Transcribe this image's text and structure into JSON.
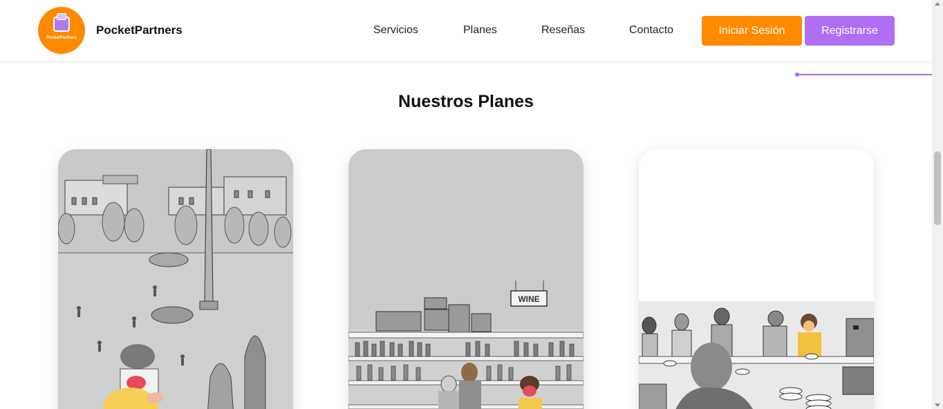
{
  "header": {
    "logo_text": "PocketPartners",
    "brand": "PocketPartners",
    "nav": [
      "Servicios",
      "Planes",
      "Reseñas",
      "Contacto"
    ],
    "login_label": "Iniciar Sesión",
    "register_label": "Registrarse"
  },
  "plans": {
    "title": "Nuestros Planes",
    "cards": [
      {
        "illustration": "city-plaza-obelisk-sketch"
      },
      {
        "illustration": "wine-shop-sketch",
        "sign_text": "WINE"
      },
      {
        "illustration": "cafe-counter-sketch"
      }
    ]
  },
  "colors": {
    "accent_orange": "#ff8a00",
    "accent_purple": "#b06ef2",
    "deco_line": "#a46af0"
  }
}
